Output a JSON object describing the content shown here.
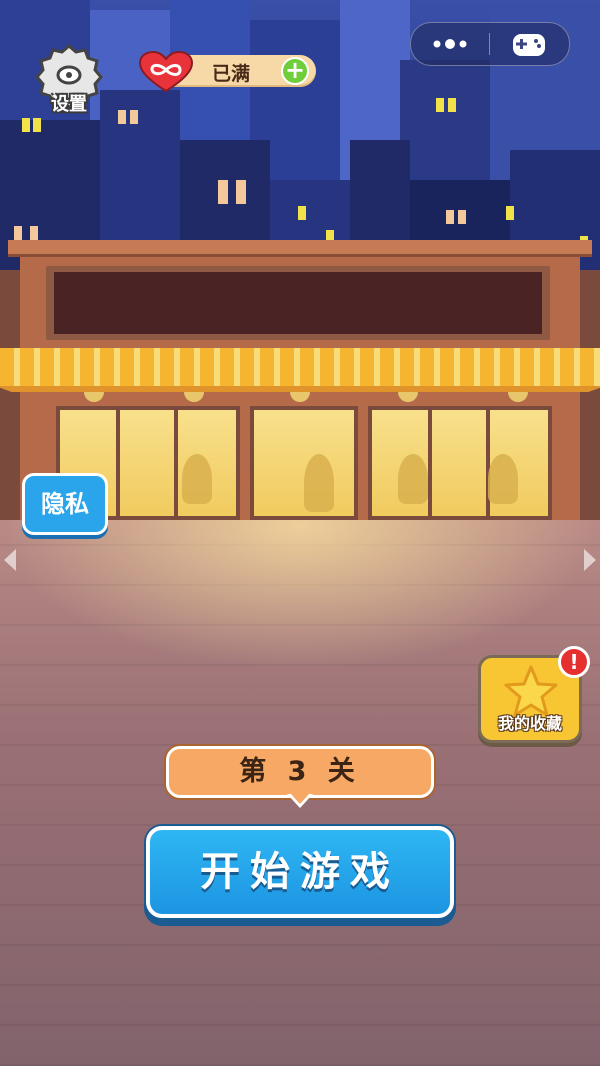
{
  "hud": {
    "settings_label": "设置",
    "lives_status": "已满",
    "settings_icon": "gear-icon",
    "lives_icon": "infinity-heart-icon",
    "add_icon": "plus-icon",
    "menu_icon": "more-dots-icon",
    "gamepad_icon": "gamepad-icon"
  },
  "side": {
    "privacy_label": "隐私",
    "favorites_label": "我的收藏",
    "favorites_badge": "!"
  },
  "level": {
    "label": "第 3 关"
  },
  "start_button": {
    "label": "开始游戏"
  },
  "colors": {
    "start_button": "#1d95e2",
    "privacy_button": "#2aa5ec",
    "level_banner": "#f6a864",
    "favorites": "#f8c533",
    "awning_stripe": "#f6b531"
  }
}
